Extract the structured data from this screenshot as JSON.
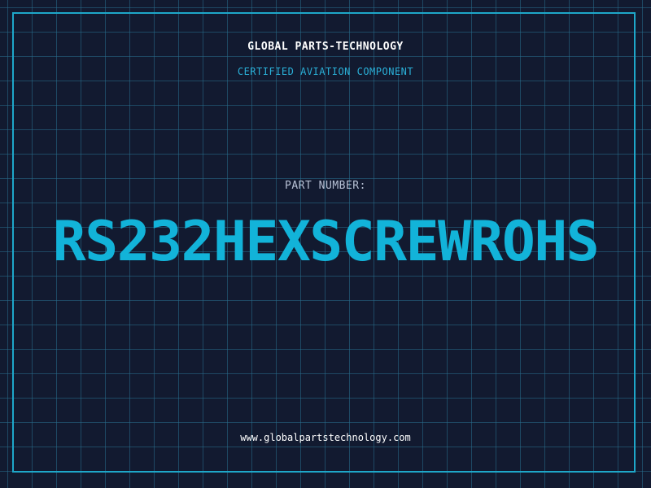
{
  "header": {
    "company": "GLOBAL PARTS-TECHNOLOGY",
    "certification": "CERTIFIED AVIATION COMPONENT"
  },
  "part": {
    "label": "PART NUMBER:",
    "number": "RS232HEXSCREWROHS"
  },
  "footer": {
    "website": "www.globalpartstechnology.com"
  },
  "colors": {
    "background": "#121a30",
    "grid": "#286e8c",
    "frame": "#1ea7c9",
    "accent": "#12b3d9"
  }
}
